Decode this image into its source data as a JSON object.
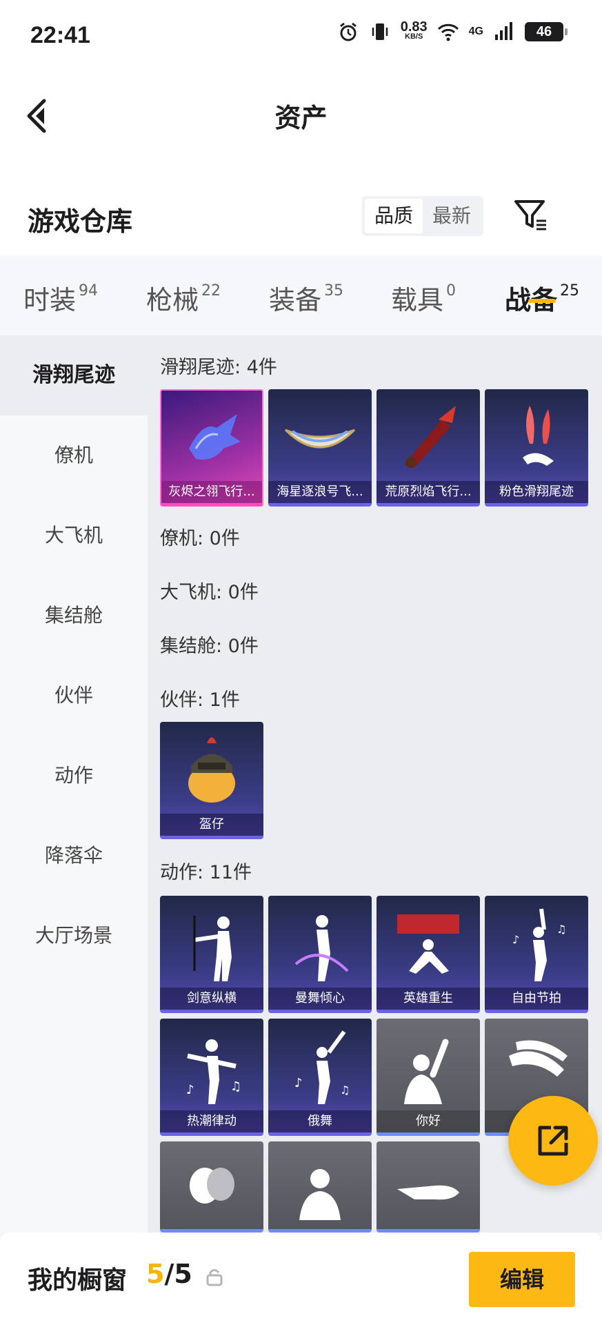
{
  "status_bar": {
    "time": "22:41",
    "speed_value": "0.83",
    "speed_unit": "KB/S",
    "network": "4G",
    "battery": "46"
  },
  "header": {
    "title": "资产"
  },
  "section": {
    "title": "游戏仓库",
    "sort_options": [
      "品质",
      "最新"
    ]
  },
  "tabs": [
    {
      "label": "时装",
      "count": "94"
    },
    {
      "label": "枪械",
      "count": "22"
    },
    {
      "label": "装备",
      "count": "35"
    },
    {
      "label": "载具",
      "count": "0"
    },
    {
      "label": "战备",
      "count": "25",
      "active": true
    }
  ],
  "sidebar": {
    "items": [
      "滑翔尾迹",
      "僚机",
      "大飞机",
      "集结舱",
      "伙伴",
      "动作",
      "降落伞",
      "大厅场景"
    ],
    "active_index": 0
  },
  "groups": {
    "glide": {
      "label": "滑翔尾迹: 4件",
      "items": [
        "灰烬之翎飞行...",
        "海星逐浪号飞...",
        "荒原烈焰飞行...",
        "粉色滑翔尾迹"
      ]
    },
    "wingman": {
      "label": "僚机: 0件"
    },
    "plane": {
      "label": "大飞机: 0件"
    },
    "pod": {
      "label": "集结舱: 0件"
    },
    "partner": {
      "label": "伙伴: 1件",
      "items": [
        "盔仔"
      ]
    },
    "emote": {
      "label": "动作: 11件",
      "items": [
        "剑意纵横",
        "曼舞倾心",
        "英雄重生",
        "自由节拍",
        "热潮律动",
        "俄舞",
        "你好"
      ]
    }
  },
  "bottom_bar": {
    "label": "我的橱窗",
    "count_current": "5",
    "count_sep": "/",
    "count_total": "5",
    "edit_label": "编辑"
  },
  "colors": {
    "accent": "#fdb813",
    "tile_purple": "#3b3d88",
    "tile_pink": "#e14ab7",
    "tile_grey": "#5b5c63"
  }
}
